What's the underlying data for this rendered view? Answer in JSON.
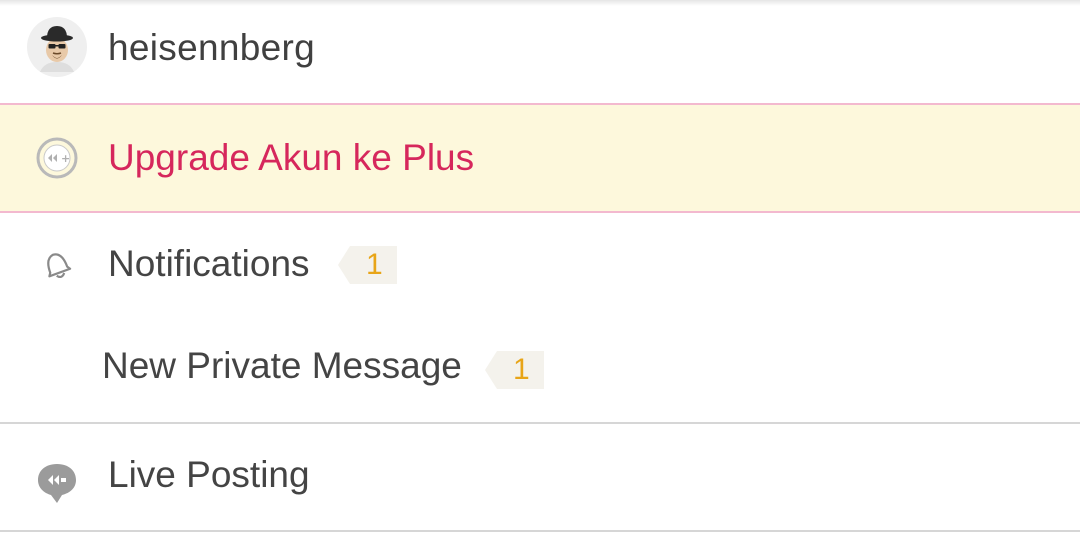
{
  "user": {
    "username": "heisennberg",
    "avatar_icon": "heisenberg-avatar-icon"
  },
  "upgrade": {
    "label": "Upgrade Akun ke Plus",
    "icon": "kaskus-plus-icon",
    "highlight_color": "#fdf8dc",
    "text_color": "#d6275c"
  },
  "notifications": {
    "label": "Notifications",
    "count": "1",
    "icon": "bell-icon"
  },
  "private_message": {
    "label": "New Private Message",
    "count": "1"
  },
  "live_posting": {
    "label": "Live Posting",
    "icon": "live-posting-chat-icon"
  },
  "colors": {
    "badge_text": "#e8a518",
    "divider": "#d6d6d6"
  }
}
